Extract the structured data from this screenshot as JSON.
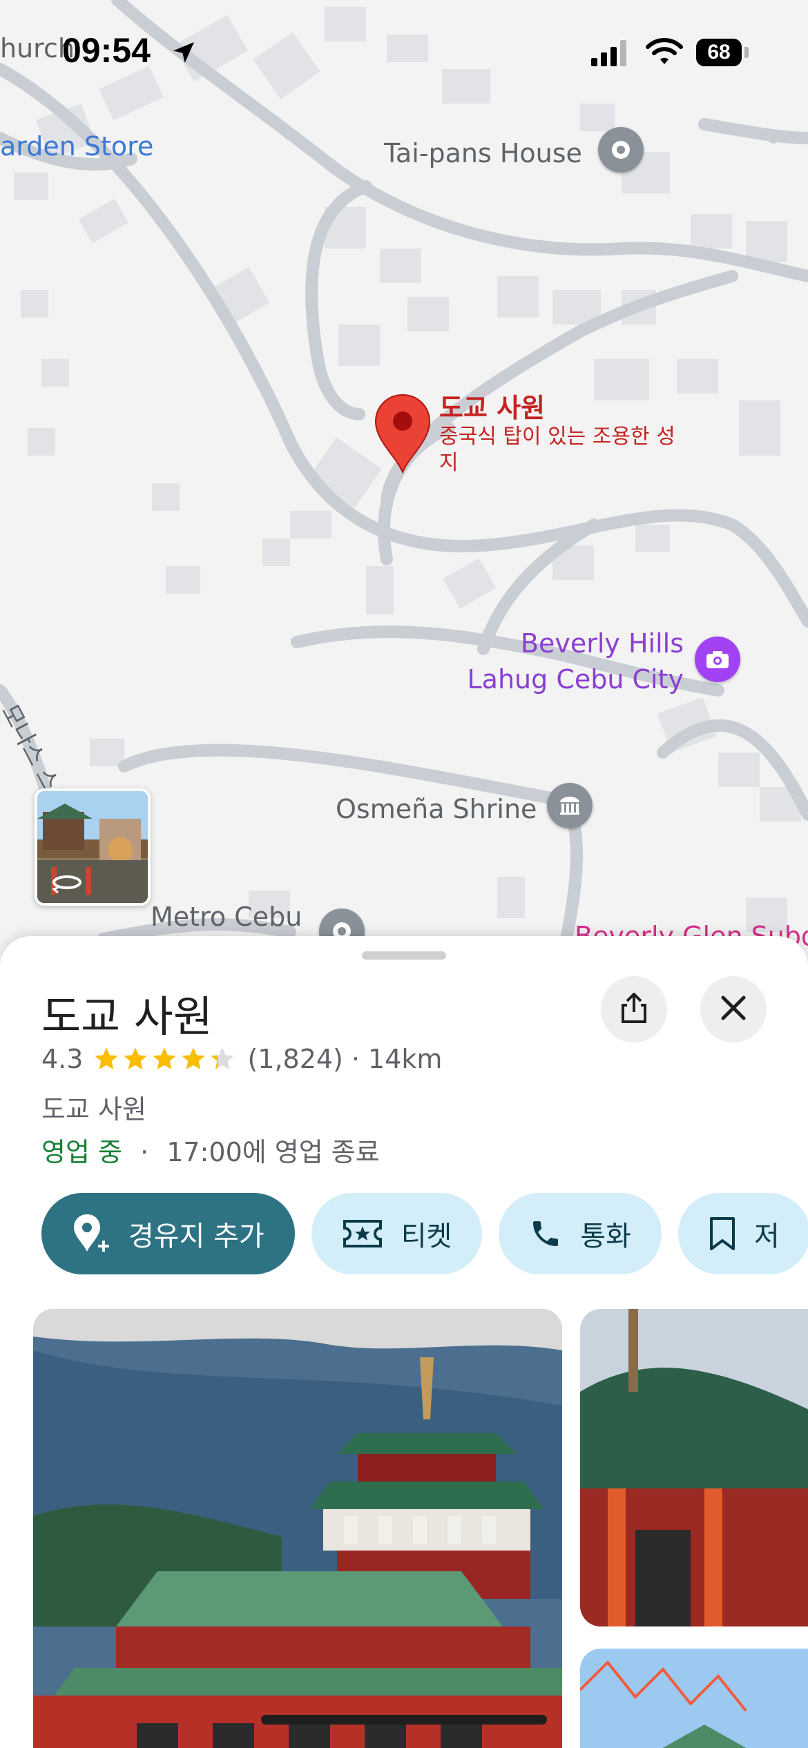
{
  "status_bar": {
    "time": "09:54",
    "battery": "68",
    "edge_label": "hurch"
  },
  "map": {
    "labels": {
      "garden_store": "arden Store",
      "tai_pans": "Tai-pans House",
      "beverly_hills_line1": "Beverly Hills",
      "beverly_hills_line2": "Lahug Cebu City",
      "osmena_shrine": "Osmeña Shrine",
      "metro_cebu": "Metro Cebu",
      "beverly_glen": "Beverly Glen Subd",
      "street_name": "모나스 스트리",
      "selected_title": "도교 사원",
      "selected_subtitle": "중국식 탑이 있는 조용한 성지"
    },
    "colors": {
      "road": "#c9ced4",
      "building": "#e2e3e6",
      "pin": "#ea4335",
      "poi_gray": "#8a9199",
      "poi_purple": "#a142f4"
    }
  },
  "place": {
    "title": "도교 사원",
    "rating": "4.3",
    "rating_value": 4.3,
    "review_count": "(1,824)",
    "distance_text": "· 14km",
    "category": "도교 사원",
    "open_status": "영업 중",
    "separator": "·",
    "closing_info": "17:00에 영업 종료"
  },
  "actions": [
    {
      "label": "경유지 추가",
      "icon": "add-location-icon"
    },
    {
      "label": "티켓",
      "icon": "ticket-icon"
    },
    {
      "label": "통화",
      "icon": "phone-icon"
    },
    {
      "label": "저",
      "icon": "bookmark-icon"
    }
  ],
  "colors": {
    "primary_action": "#2e7384",
    "secondary_action": "#d3eef8",
    "open_green": "#188038",
    "star": "#fbbc04"
  }
}
